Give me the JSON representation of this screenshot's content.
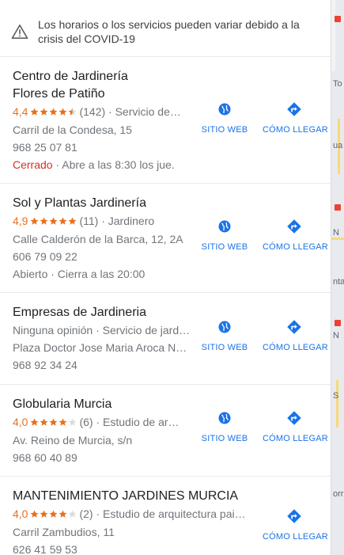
{
  "banner": {
    "icon": "warning-icon",
    "text": "Los horarios o los servicios pueden variar debido a la crisis del COVID-19"
  },
  "map_labels": [
    "To",
    "ua",
    "N",
    "nta",
    "N",
    "S",
    "orre"
  ],
  "results": [
    {
      "name_line1": "Centro de Jardinería",
      "name_line2": "Flores de Patiño",
      "rating": "4,4",
      "stars": 4.5,
      "reviews": "(142)",
      "category": "· Servicio de…",
      "address": "Carril de la Condesa, 15",
      "phone": "968 25 07 81",
      "status": "Cerrado",
      "hours": "· Abre a las 8:30 los jue.",
      "website_label": "SITIO WEB",
      "directions_label": "CÓMO LLEGAR"
    },
    {
      "name_line1": "Sol y Plantas Jardinería",
      "rating": "4,9",
      "stars": 5,
      "reviews": "(11)",
      "category": "· Jardinero",
      "address": "Calle Calderón de la Barca, 12, 2A",
      "phone": "606 79 09 22",
      "status": "Abierto",
      "hours": "· Cierra a las 20:00",
      "website_label": "SITIO WEB",
      "directions_label": "CÓMO LLEGAR"
    },
    {
      "name_line1": "Empresas de Jardineria",
      "no_reviews": "Ninguna opinión",
      "category": "· Servicio de jard…",
      "address": "Plaza Doctor Jose Maria Aroca N…",
      "phone": "968 92 34 24",
      "website_label": "SITIO WEB",
      "directions_label": "CÓMO LLEGAR"
    },
    {
      "name_line1": "Globularia Murcia",
      "rating": "4,0",
      "stars": 4,
      "reviews": "(6)",
      "category": "· Estudio de ar…",
      "address": "Av. Reino de Murcia, s/n",
      "phone": "968 60 40 89",
      "website_label": "SITIO WEB",
      "directions_label": "CÓMO LLEGAR"
    },
    {
      "name_line1": "MANTENIMIENTO JARDINES MURCIA",
      "rating": "4,0",
      "stars": 4,
      "reviews": "(2)",
      "category": "· Estudio de arquitectura pai…",
      "address": "Carril Zambudios, 11",
      "phone": "626 41 59 53",
      "directions_label": "CÓMO LLEGAR"
    }
  ],
  "colors": {
    "accent": "#1a73e8",
    "star": "#e7711b",
    "closed": "#d93025",
    "muted": "#70757a"
  }
}
